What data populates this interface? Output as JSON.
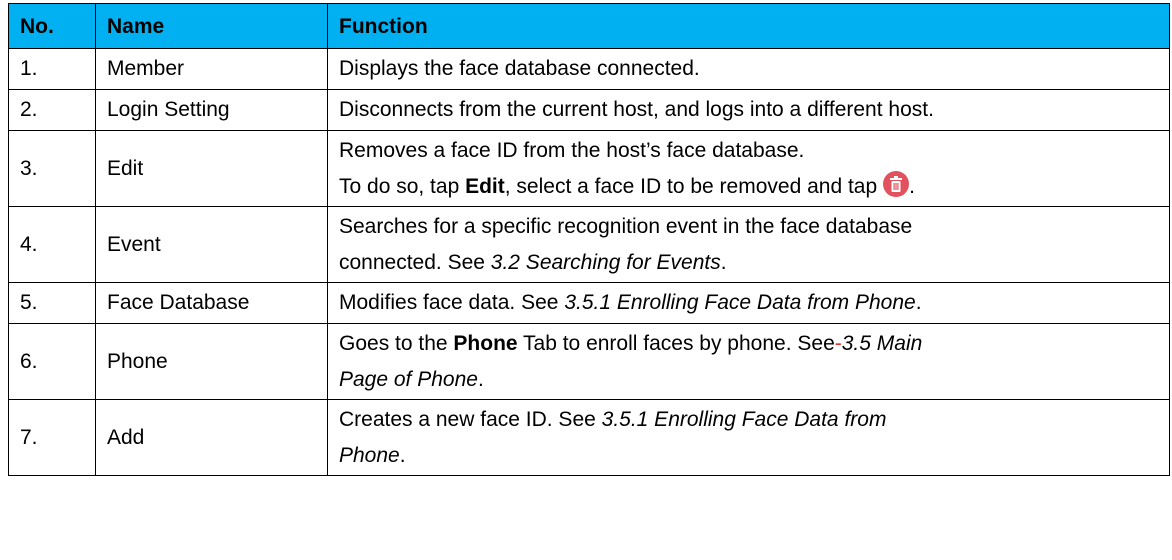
{
  "headers": {
    "no": "No.",
    "name": "Name",
    "function": "Function"
  },
  "rows": [
    {
      "no": "1.",
      "name": "Member",
      "l1": [
        "Displays the face database connected."
      ]
    },
    {
      "no": "2.",
      "name": "Login Setting",
      "l1": [
        "Disconnects from the current host, and logs into a different host."
      ]
    },
    {
      "no": "3.",
      "name": "Edit",
      "l1": [
        "Removes a face ID from the host’s face database."
      ],
      "l2": [
        "To do so, tap ",
        "Edit",
        ", select a face ID to be removed and tap",
        "."
      ]
    },
    {
      "no": "4.",
      "name": "Event",
      "l1": [
        "Searches for a specific recognition event in the face database"
      ],
      "l2": [
        "connected. See ",
        "3.2 Searching for Events",
        "."
      ]
    },
    {
      "no": "5.",
      "name": "Face Database",
      "l1": [
        "Modifies face data. See ",
        "3.5.1 Enrolling Face Data from Phone",
        "."
      ]
    },
    {
      "no": "6.",
      "name": "Phone",
      "l1": [
        "Goes to the ",
        "Phone",
        " Tab to enroll faces by phone. See",
        "-",
        "3.5 Main"
      ],
      "l2": [
        "Page of Phone",
        "."
      ]
    },
    {
      "no": "7.",
      "name": "Add",
      "l1": [
        "Creates a new face ID. See ",
        "3.5.1 Enrolling Face Data from"
      ],
      "l2": [
        "Phone",
        "."
      ]
    }
  ],
  "colors": {
    "header_bg": "#00b0f0",
    "trash_icon": "#e2525e",
    "accent_dash": "#e03030"
  },
  "icons": {
    "delete": "trash-icon"
  }
}
